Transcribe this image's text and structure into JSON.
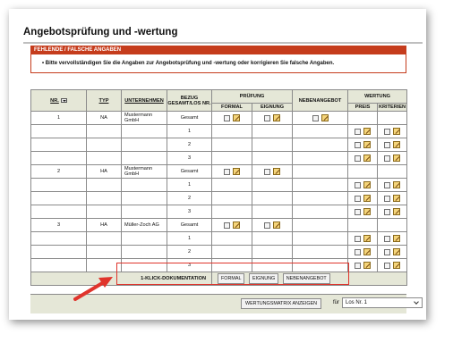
{
  "title": "Angebotsprüfung und -wertung",
  "alert": {
    "heading": "FEHLENDE / FALSCHE ANGABEN",
    "message": "Bitte vervollständigen Sie die Angaben zur Angebotsprüfung und -wertung oder korrigieren Sie falsche Angaben."
  },
  "table": {
    "headers": {
      "nr": "NR.",
      "typ": "TYP",
      "unternehmen": "UNTERNEHMEN",
      "bezug": "BEZUG GESAMT/LOS NR.",
      "pruefung": "PRÜFUNG",
      "formal": "FORMAL",
      "eignung": "EIGNUNG",
      "nebenangebot": "NEBENANGEBOT",
      "wertung": "WERTUNG",
      "preis": "PREIS",
      "kriterien": "KRITERIEN"
    },
    "rows": [
      {
        "nr": "1",
        "typ": "NA",
        "unternehmen": "Mustermann GmbH",
        "bezug": "Gesamt",
        "kind": "main",
        "neben": true
      },
      {
        "nr": "",
        "typ": "",
        "unternehmen": "",
        "bezug": "1",
        "kind": "los"
      },
      {
        "nr": "",
        "typ": "",
        "unternehmen": "",
        "bezug": "2",
        "kind": "los"
      },
      {
        "nr": "",
        "typ": "",
        "unternehmen": "",
        "bezug": "3",
        "kind": "los"
      },
      {
        "nr": "2",
        "typ": "HA",
        "unternehmen": "Mustermann GmbH",
        "bezug": "Gesamt",
        "kind": "main",
        "neben": false
      },
      {
        "nr": "",
        "typ": "",
        "unternehmen": "",
        "bezug": "1",
        "kind": "los"
      },
      {
        "nr": "",
        "typ": "",
        "unternehmen": "",
        "bezug": "2",
        "kind": "los"
      },
      {
        "nr": "",
        "typ": "",
        "unternehmen": "",
        "bezug": "3",
        "kind": "los"
      },
      {
        "nr": "3",
        "typ": "HA",
        "unternehmen": "Müller-Zoch AG",
        "bezug": "Gesamt",
        "kind": "main",
        "neben": false
      },
      {
        "nr": "",
        "typ": "",
        "unternehmen": "",
        "bezug": "1",
        "kind": "los"
      },
      {
        "nr": "",
        "typ": "",
        "unternehmen": "",
        "bezug": "2",
        "kind": "los"
      },
      {
        "nr": "",
        "typ": "",
        "unternehmen": "",
        "bezug": "3",
        "kind": "los"
      }
    ]
  },
  "footer": {
    "label": "1-KLICK-DOKUMENTATION",
    "buttons": [
      "FORMAL",
      "EIGNUNG",
      "NEBENANGEBOT"
    ]
  },
  "bottom": {
    "matrix_button": "WERTUNGSMATRIX ANZEIGEN",
    "fuer": "für",
    "select_value": "Los Nr. 1"
  },
  "colors": {
    "alert_red": "#c53c1c",
    "header_bg": "#e5e7d7",
    "highlight": "#e0342c"
  },
  "icons": {
    "checkbox": "checkbox",
    "edit": "edit-pencil-icon",
    "sort": "sort-icon"
  }
}
